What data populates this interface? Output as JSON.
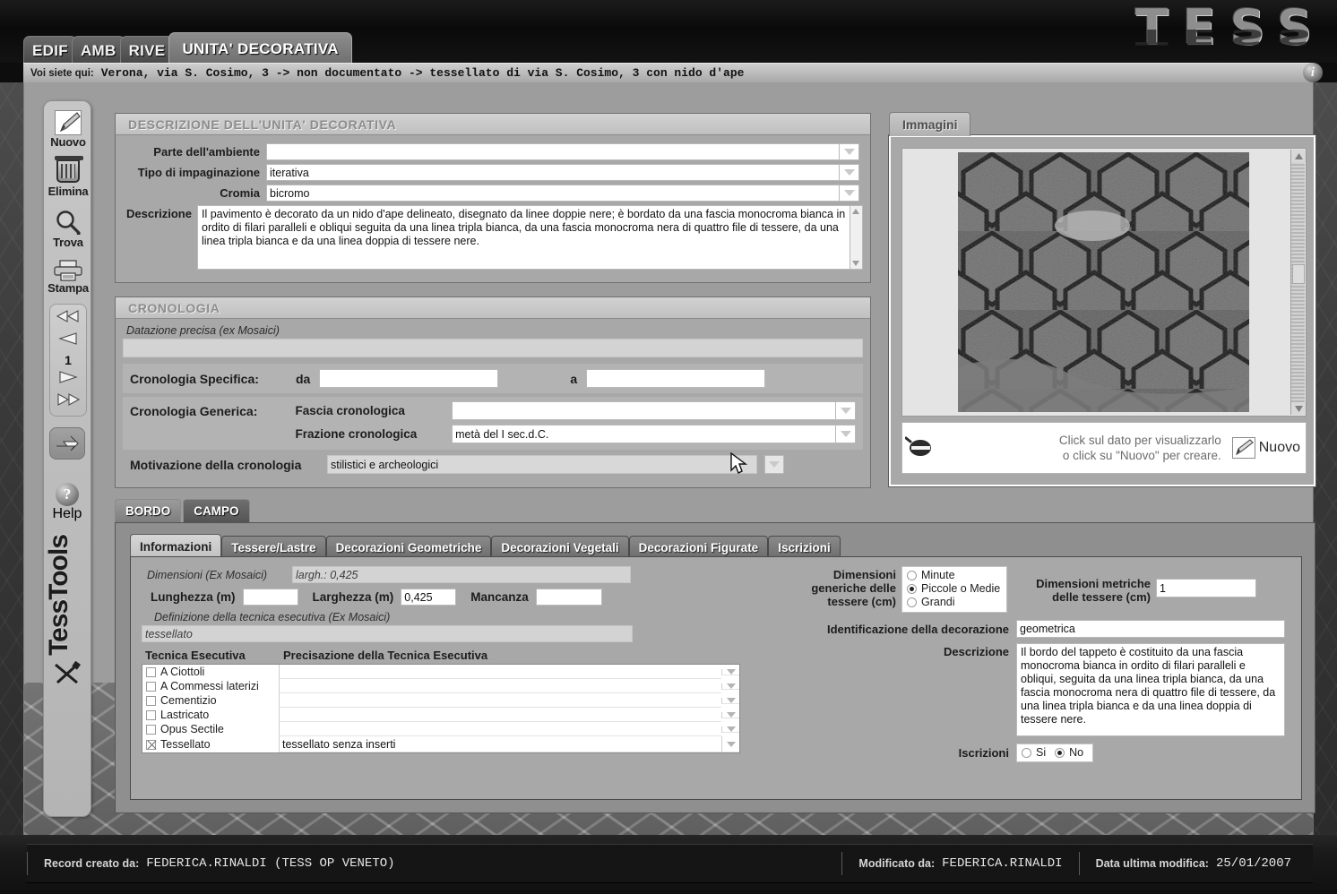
{
  "app": {
    "logo": "TESS",
    "info_icon": "i"
  },
  "main_tabs": [
    {
      "label": "EDIF",
      "active": false
    },
    {
      "label": "AMB",
      "active": false
    },
    {
      "label": "RIVE",
      "active": false
    },
    {
      "label": "UNITA' DECORATIVA",
      "active": true
    }
  ],
  "breadcrumb": {
    "lead": "Voi siete qui:",
    "path": "Verona, via S. Cosimo, 3  -> non documentato -> tessellato di via S. Cosimo, 3 con nido d'ape"
  },
  "toolbar": {
    "items": [
      {
        "label": "Nuovo",
        "icon": "pencil-icon"
      },
      {
        "label": "Elimina",
        "icon": "trash-icon"
      },
      {
        "label": "Trova",
        "icon": "magnifier-icon"
      },
      {
        "label": "Stampa",
        "icon": "printer-icon"
      }
    ],
    "nav": {
      "first": "first-icon",
      "prev": "prev-icon",
      "record": "1",
      "next": "next-icon",
      "last": "last-icon"
    },
    "go_label": "go-icon",
    "help": {
      "label": "Help",
      "glyph": "?"
    },
    "brand": "TessTools",
    "brand_icon": "tools-icon"
  },
  "descrizione_panel": {
    "title": "DESCRIZIONE DELL'UNITA' DECORATIVA",
    "fields": [
      {
        "label": "Parte dell'ambiente",
        "value": "",
        "dropdown": true
      },
      {
        "label": "Tipo di impaginazione",
        "value": "iterativa",
        "dropdown": true
      },
      {
        "label": "Cromia",
        "value": "bicromo",
        "dropdown": true
      }
    ],
    "descrizione_label": "Descrizione",
    "descrizione_value": "Il pavimento è decorato da un nido d'ape delineato, disegnato da linee doppie nere; è bordato da una fascia monocroma bianca in ordito di filari paralleli e obliqui seguita da una linea tripla bianca, da una fascia monocroma nera di quattro file di tessere, da una linea tripla bianca e da una linea doppia di tessere nere."
  },
  "cronologia_panel": {
    "title": "CRONOLOGIA",
    "datazione_label": "Datazione precisa (ex Mosaici)",
    "datazione_value": "",
    "specifica_label": "Cronologia Specifica:",
    "da_label": "da",
    "da_value": "",
    "a_label": "a",
    "a_value": "",
    "generica_label": "Cronologia Generica:",
    "fascia_label": "Fascia cronologica",
    "fascia_value": "",
    "frazione_label": "Frazione cronologica",
    "frazione_value": "metà del I sec.d.C.",
    "motivazione_label": "Motivazione della cronologia",
    "motivazione_value": "stilistici e archeologici"
  },
  "immagini_panel": {
    "tab_label": "Immagini",
    "hint_line1": "Click sul dato per visualizzarlo",
    "hint_line2": "o click su \"Nuovo\" per creare.",
    "nuovo_label": "Nuovo",
    "magnifier_icon": "magnifier-icon",
    "photo_alt": "hexagonal-mosaic-photo"
  },
  "bordo_campo_tabs": [
    {
      "label": "BORDO",
      "active": true
    },
    {
      "label": "CAMPO",
      "active": false
    }
  ],
  "inner_tabs": [
    {
      "label": "Informazioni",
      "active": true
    },
    {
      "label": "Tessere/Lastre",
      "active": false
    },
    {
      "label": "Decorazioni Geometriche",
      "active": false
    },
    {
      "label": "Decorazioni Vegetali",
      "active": false
    },
    {
      "label": "Decorazioni Figurate",
      "active": false
    },
    {
      "label": "Iscrizioni",
      "active": false
    }
  ],
  "informazioni": {
    "dimensioni_ex_label": "Dimensioni (Ex Mosaici)",
    "dimensioni_ex_value": "largh.: 0,425",
    "lunghezza_label": "Lunghezza (m)",
    "lunghezza_value": "",
    "larghezza_label": "Larghezza (m)",
    "larghezza_value": "0,425",
    "mancanza_label": "Mancanza",
    "mancanza_value": "",
    "definizione_label": "Definizione della tecnica esecutiva (Ex Mosaici)",
    "definizione_value": "tessellato",
    "tecnica_col": "Tecnica Esecutiva",
    "precisazione_col": "Precisazione della Tecnica Esecutiva",
    "tecniche": [
      {
        "name": "A Ciottoli",
        "checked": false,
        "precisazione": ""
      },
      {
        "name": "A Commessi laterizi",
        "checked": false,
        "precisazione": ""
      },
      {
        "name": "Cementizio",
        "checked": false,
        "precisazione": ""
      },
      {
        "name": "Lastricato",
        "checked": false,
        "precisazione": ""
      },
      {
        "name": "Opus Sectile",
        "checked": false,
        "precisazione": ""
      },
      {
        "name": "Tessellato",
        "checked": true,
        "precisazione": "tessellato senza inserti"
      }
    ],
    "dim_generiche_label_l1": "Dimensioni",
    "dim_generiche_label_l2": "generiche delle",
    "dim_generiche_label_l3": "tessere (cm)",
    "dim_generiche_options": [
      {
        "label": "Minute",
        "selected": false
      },
      {
        "label": "Piccole o Medie",
        "selected": true
      },
      {
        "label": "Grandi",
        "selected": false
      }
    ],
    "dim_metriche_label_l1": "Dimensioni metriche",
    "dim_metriche_label_l2": "delle tessere (cm)",
    "dim_metriche_value": "1",
    "identificazione_label": "Identificazione della decorazione",
    "identificazione_value": "geometrica",
    "descrizione_label": "Descrizione",
    "descrizione_value": "Il bordo del tappeto è costituito da una fascia monocroma bianca in ordito di filari paralleli e obliqui, seguita da una linea tripla bianca, da una fascia monocroma nera di quattro file di tessere, da una linea tripla bianca e da una linea doppia di tessere nere.",
    "iscrizioni_label": "Iscrizioni",
    "iscrizioni_options": [
      {
        "label": "Si",
        "selected": false
      },
      {
        "label": "No",
        "selected": true
      }
    ]
  },
  "footer": {
    "created_label": "Record creato da:",
    "created_value": "FEDERICA.RINALDI  (TESS OP VENETO)",
    "modified_label": "Modificato da:",
    "modified_value": "FEDERICA.RINALDI",
    "date_label": "Data ultima modifica:",
    "date_value": "25/01/2007"
  },
  "colors": {
    "panel_bg": "#a8a8a8",
    "field_bg": "#ffffff",
    "header_text": "#8c8c8c",
    "accent": "#6f6f6f"
  }
}
